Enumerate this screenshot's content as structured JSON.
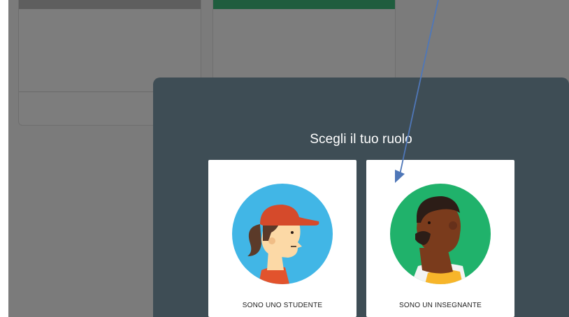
{
  "dialog": {
    "title": "Scegli il tuo ruolo"
  },
  "roles": [
    {
      "label": "SONO UNO STUDENTE",
      "icon": "student-avatar-icon",
      "circle_color": "#41b6e6"
    },
    {
      "label": "SONO UN INSEGNANTE",
      "icon": "teacher-avatar-icon",
      "circle_color": "#20b26b"
    }
  ],
  "colors": {
    "dialog_background": "#3e4d55",
    "overlay": "#7b7b7b",
    "annotation_arrow": "#4f77b8"
  }
}
